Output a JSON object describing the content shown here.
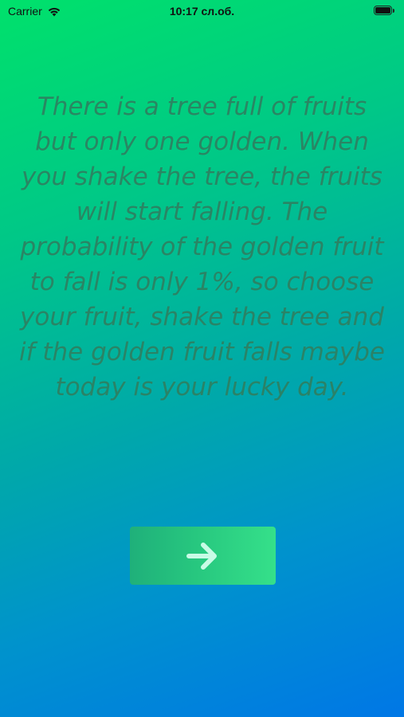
{
  "status_bar": {
    "carrier": "Carrier",
    "time": "10:17 сл.об."
  },
  "intro": {
    "text": "There is a tree full of fruits but only one golden. When you shake the tree, the fruits will start falling. The probability of the golden fruit to fall is only 1%, so choose your fruit, shake the tree and if the golden fruit falls maybe today is your lucky day."
  },
  "next_button": {
    "icon": "arrow-right-icon"
  },
  "colors": {
    "gradient_top": "#00e16b",
    "gradient_bottom": "#0077e6",
    "text": "#2f7f60",
    "button": "#27c77f",
    "arrow": "#c8fbe6"
  }
}
